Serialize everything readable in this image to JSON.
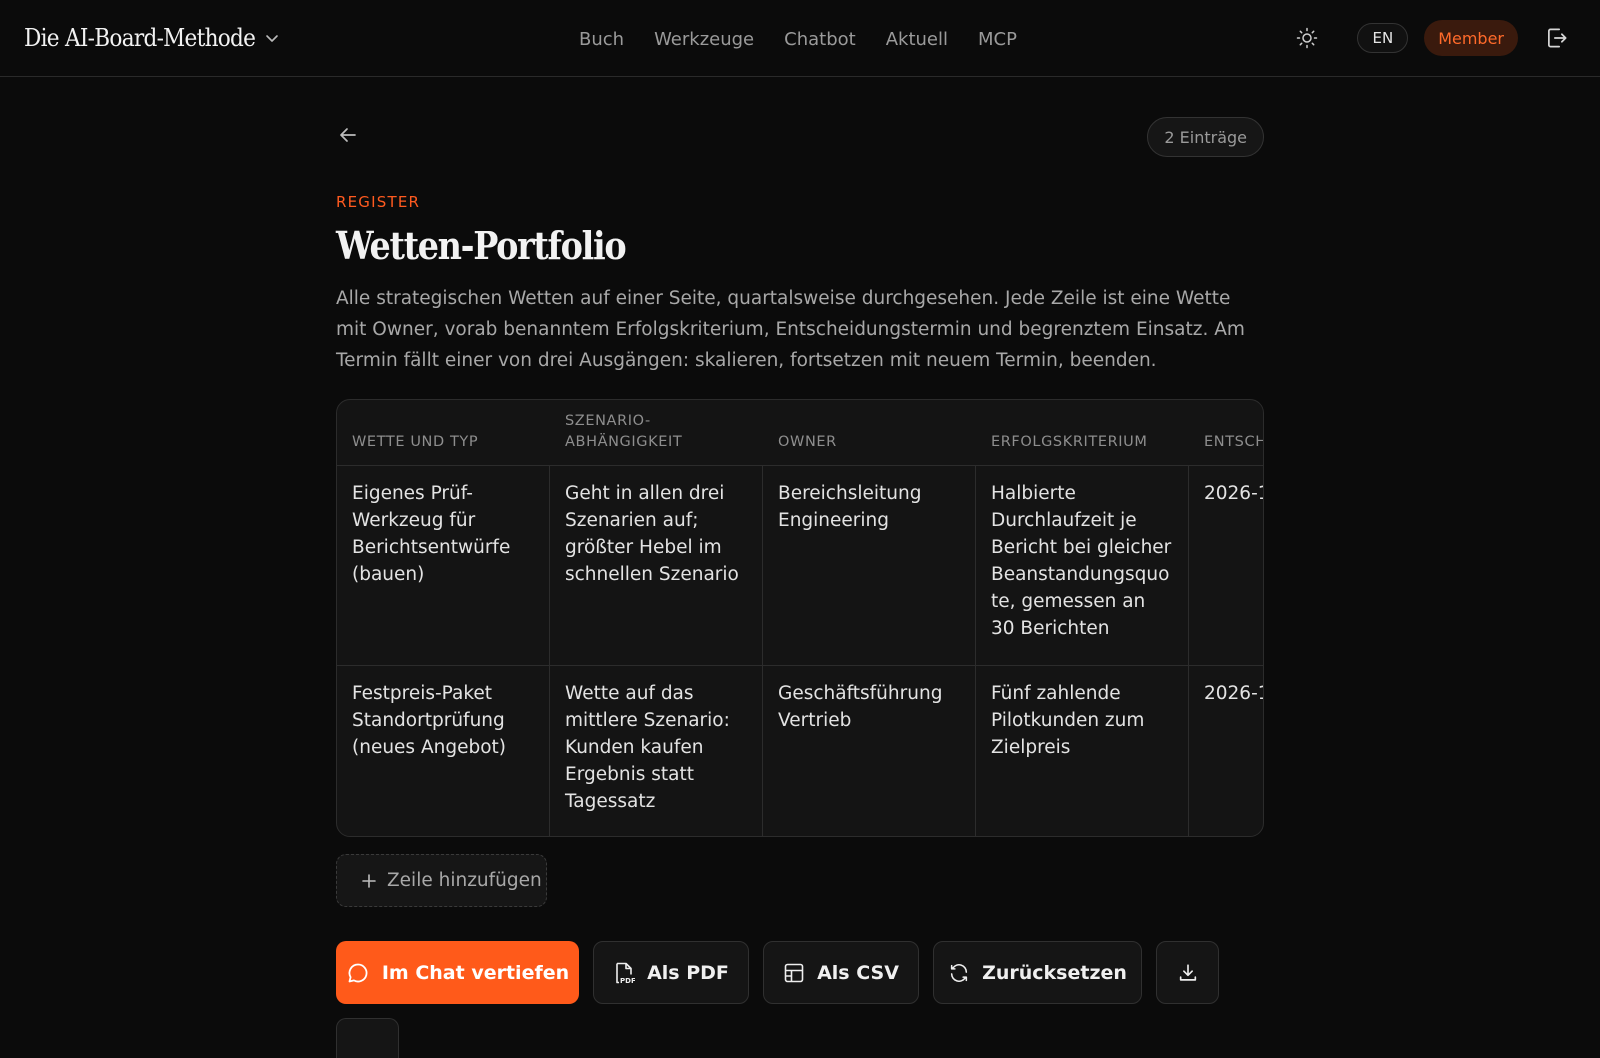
{
  "app": {
    "brand": "Die AI-Board-Methode",
    "nav": [
      "Buch",
      "Werkzeuge",
      "Chatbot",
      "Aktuell",
      "MCP"
    ],
    "lang": "EN",
    "member": "Member"
  },
  "page": {
    "entries": "2 Einträge",
    "eyebrow": "REGISTER",
    "title": "Wetten-Portfolio",
    "intro": "Alle strategischen Wetten auf einer Seite, quartalsweise durchgesehen. Jede Zeile ist eine Wette mit Owner, vorab benanntem Erfolgskriterium, Entscheidungstermin und begrenztem Einsatz. Am Termin fällt einer von drei Ausgängen: skalieren, fortsetzen mit neuem Termin, beenden."
  },
  "table": {
    "columns": [
      "WETTE UND TYP",
      "SZENARIO-\nABHÄNGIGKEIT",
      "OWNER",
      "ERFOLGSKRITERIUM",
      "ENTSCH"
    ],
    "rows": [
      [
        "Eigenes Prüf-Werkzeug für Berichtsentwürfe (bauen)",
        "Geht in allen drei Szenarien auf; größter Hebel im schnellen Szenario",
        "Bereichsleitung Engineering",
        "Halbierte Durchlaufzeit je Bericht bei gleicher Beanstandungsquote, gemessen an 30 Berichten",
        "2026-1"
      ],
      [
        "Festpreis-Paket Standortprüfung (neues Angebot)",
        "Wette auf das mittlere Szenario: Kunden kaufen Ergebnis statt Tagessatz",
        "Geschäftsführung Vertrieb",
        "Fünf zahlende Pilotkunden zum Zielpreis",
        "2026-1"
      ]
    ]
  },
  "actions": {
    "add_row": "Zeile hinzufügen",
    "chat": "Im Chat vertiefen",
    "pdf": "Als PDF",
    "csv": "Als CSV",
    "reset": "Zurücksetzen"
  }
}
